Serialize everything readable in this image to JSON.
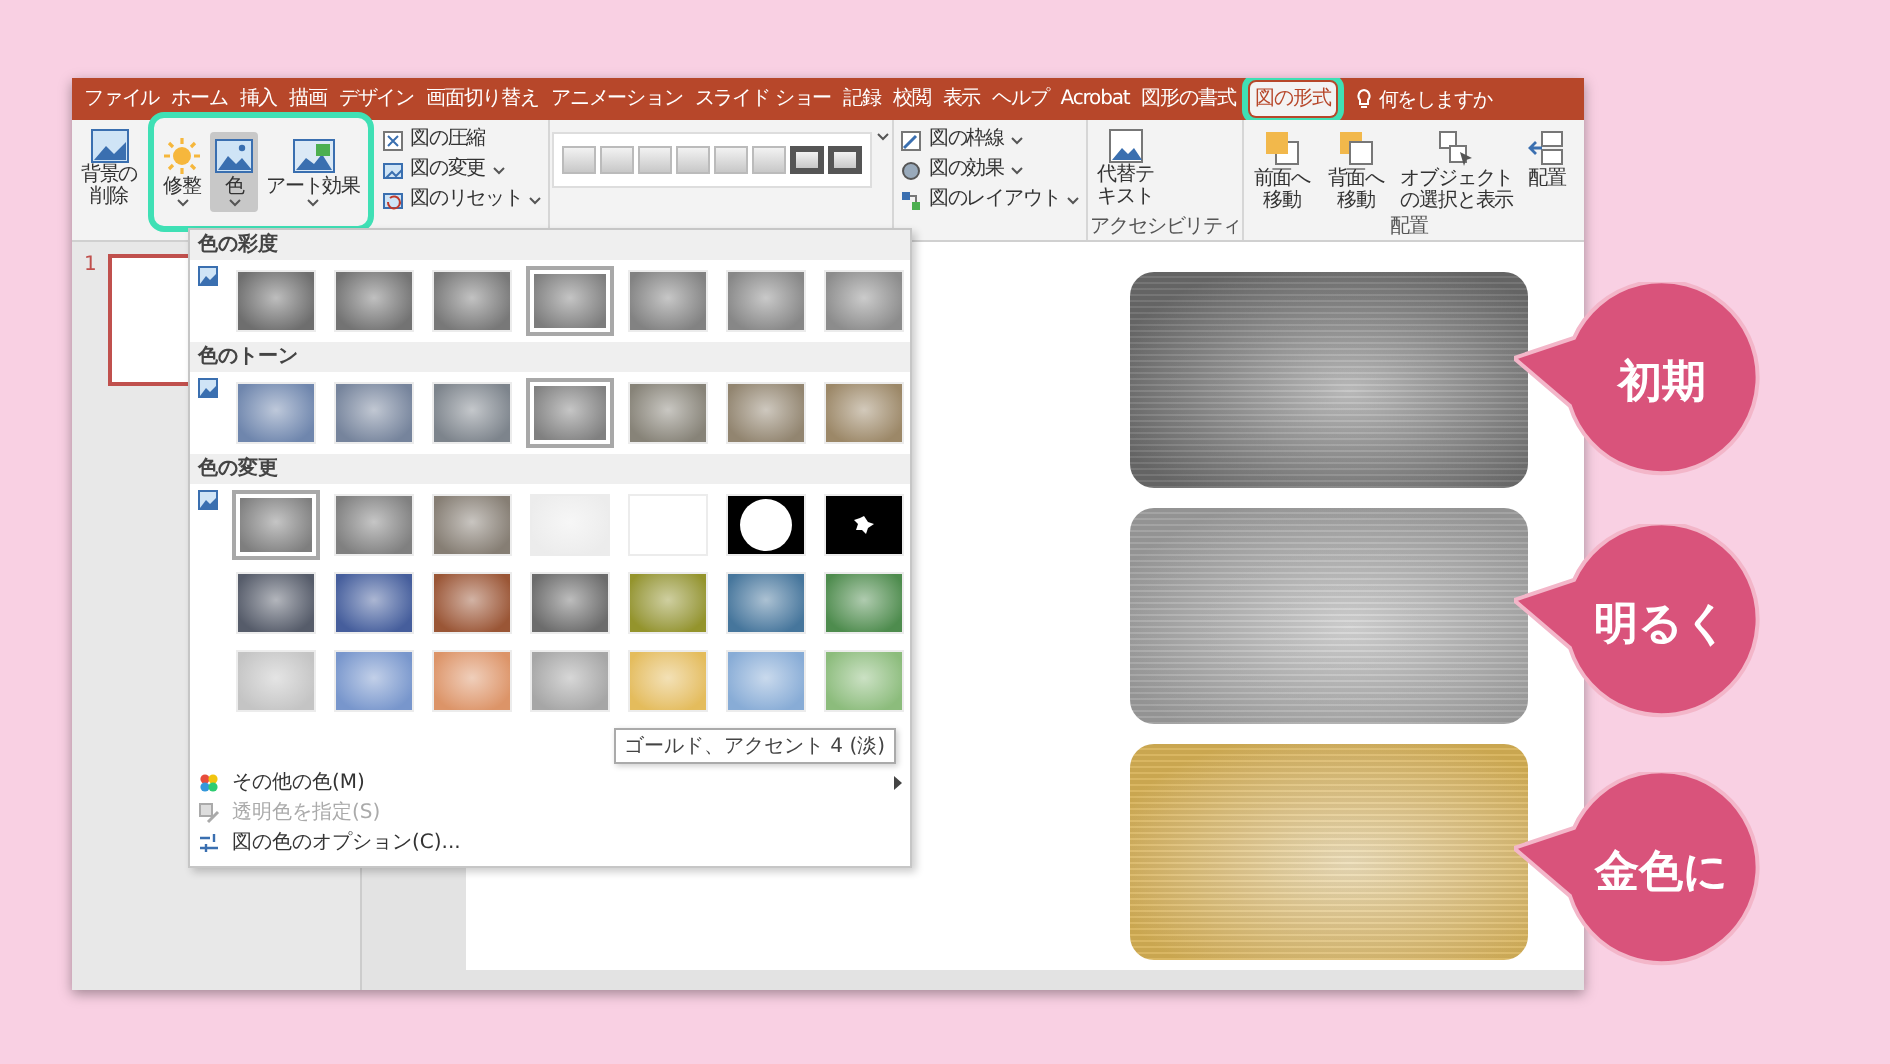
{
  "ribbon_tabs": [
    {
      "label": "ファイル",
      "selected": false
    },
    {
      "label": "ホーム",
      "selected": false
    },
    {
      "label": "挿入",
      "selected": false
    },
    {
      "label": "描画",
      "selected": false
    },
    {
      "label": "デザイン",
      "selected": false
    },
    {
      "label": "画面切り替え",
      "selected": false
    },
    {
      "label": "アニメーション",
      "selected": false
    },
    {
      "label": "スライド ショー",
      "selected": false
    },
    {
      "label": "記録",
      "selected": false
    },
    {
      "label": "校閲",
      "selected": false
    },
    {
      "label": "表示",
      "selected": false
    },
    {
      "label": "ヘルプ",
      "selected": false
    },
    {
      "label": "Acrobat",
      "selected": false
    },
    {
      "label": "図形の書式",
      "selected": false
    },
    {
      "label": "図の形式",
      "selected": true
    }
  ],
  "tell_me": "何をしますか",
  "ribbon": {
    "remove_background": "背景の削除",
    "adjust_buttons": [
      {
        "label": "修整",
        "kind": "sun",
        "selected": false
      },
      {
        "label": "色",
        "kind": "picture",
        "selected": true
      },
      {
        "label": "アート効果",
        "kind": "art",
        "selected": false
      }
    ],
    "picture_commands": [
      {
        "label": "図の圧縮",
        "dropdown": false,
        "kind": "compress"
      },
      {
        "label": "図の変更",
        "dropdown": true,
        "kind": "change"
      },
      {
        "label": "図のリセット",
        "dropdown": true,
        "kind": "reset"
      }
    ],
    "styles": [
      {
        "framed": false
      },
      {
        "framed": false
      },
      {
        "framed": false
      },
      {
        "framed": false
      },
      {
        "framed": false
      },
      {
        "framed": false
      },
      {
        "framed": true
      },
      {
        "framed": true
      }
    ],
    "border_commands": [
      {
        "label": "図の枠線",
        "kind": "pen"
      },
      {
        "label": "図の効果",
        "kind": "effects"
      },
      {
        "label": "図のレイアウト",
        "kind": "layout"
      }
    ],
    "alt_text": "代替テキスト",
    "accessibility_label": "アクセシビリティ",
    "arrange": [
      {
        "label": "前面へ移動",
        "kind": "forward"
      },
      {
        "label": "背面へ移動",
        "kind": "backward"
      },
      {
        "label": "オブジェクトの選択と表示",
        "kind": "selection"
      },
      {
        "label": "配置",
        "kind": "align"
      }
    ],
    "arrange_label": "配置"
  },
  "color_menu": {
    "sections": [
      {
        "title": "色の彩度",
        "swatches": [
          {
            "kind": "gradient",
            "color": "#6e6e6e",
            "selected": false
          },
          {
            "kind": "gradient",
            "color": "#737373",
            "selected": false
          },
          {
            "kind": "gradient",
            "color": "#787878",
            "selected": false
          },
          {
            "kind": "gradient",
            "color": "#7d7d7d",
            "selected": true
          },
          {
            "kind": "gradient",
            "color": "#828282",
            "selected": false
          },
          {
            "kind": "gradient",
            "color": "#878787",
            "selected": false
          },
          {
            "kind": "gradient",
            "color": "#8c8c8c",
            "selected": false
          }
        ]
      },
      {
        "title": "色のトーン",
        "swatches": [
          {
            "kind": "gradient",
            "color": "#6f86ad",
            "selected": false
          },
          {
            "kind": "gradient",
            "color": "#76849c",
            "selected": false
          },
          {
            "kind": "gradient",
            "color": "#7d848c",
            "selected": false
          },
          {
            "kind": "gradient",
            "color": "#808080",
            "selected": true
          },
          {
            "kind": "gradient",
            "color": "#878378",
            "selected": false
          },
          {
            "kind": "gradient",
            "color": "#928570",
            "selected": false
          },
          {
            "kind": "gradient",
            "color": "#9c8868",
            "selected": false
          }
        ]
      },
      {
        "title": "色の変更",
        "swatches": [
          {
            "kind": "gradient",
            "color": "#7e7e7e",
            "selected": true
          },
          {
            "kind": "gradient",
            "color": "#808080",
            "selected": false
          },
          {
            "kind": "gradient",
            "color": "#867e74",
            "selected": false
          },
          {
            "kind": "gradient",
            "color": "#ececec",
            "selected": false
          },
          {
            "kind": "gradient",
            "color": "#ffffff",
            "selected": false
          },
          {
            "kind": "blob",
            "color": "#000000",
            "selected": false
          },
          {
            "kind": "dot",
            "color": "#000000",
            "selected": false
          },
          {
            "kind": "gradient",
            "color": "#565c6a",
            "selected": false
          },
          {
            "kind": "gradient",
            "color": "#465e9c",
            "selected": false
          },
          {
            "kind": "gradient",
            "color": "#9a5636",
            "selected": false
          },
          {
            "kind": "gradient",
            "color": "#6c6c6c",
            "selected": false
          },
          {
            "kind": "gradient",
            "color": "#94942c",
            "selected": false
          },
          {
            "kind": "gradient",
            "color": "#46769c",
            "selected": false
          },
          {
            "kind": "gradient",
            "color": "#4e8c4e",
            "selected": false
          },
          {
            "kind": "gradient",
            "color": "#c4c4c4",
            "selected": false
          },
          {
            "kind": "gradient",
            "color": "#7896cc",
            "selected": false
          },
          {
            "kind": "gradient",
            "color": "#dc9468",
            "selected": false
          },
          {
            "kind": "gradient",
            "color": "#a6a6a6",
            "selected": false
          },
          {
            "kind": "gradient",
            "color": "#e4bc5c",
            "selected": false
          },
          {
            "kind": "gradient",
            "color": "#88acd6",
            "selected": false
          },
          {
            "kind": "gradient",
            "color": "#8cbc7c",
            "selected": false
          }
        ]
      }
    ],
    "items": [
      {
        "label": "その他の色(M)",
        "kind": "palette",
        "disabled": false,
        "submenu": true
      },
      {
        "label": "透明色を指定(S)",
        "kind": "transparent",
        "disabled": true,
        "submenu": false
      },
      {
        "label": "図の色のオプション(C)...",
        "kind": "options",
        "disabled": false,
        "submenu": false
      }
    ],
    "tooltip": "ゴールド、アクセント 4 (淡)"
  },
  "slide_number": "1",
  "slide_images": [
    {
      "color": "#6a6a6a"
    },
    {
      "color": "#9c9c9c"
    },
    {
      "color": "#d6b055"
    }
  ],
  "callouts": [
    {
      "label": "初期"
    },
    {
      "label": "明るく"
    },
    {
      "label": "金色に"
    }
  ]
}
